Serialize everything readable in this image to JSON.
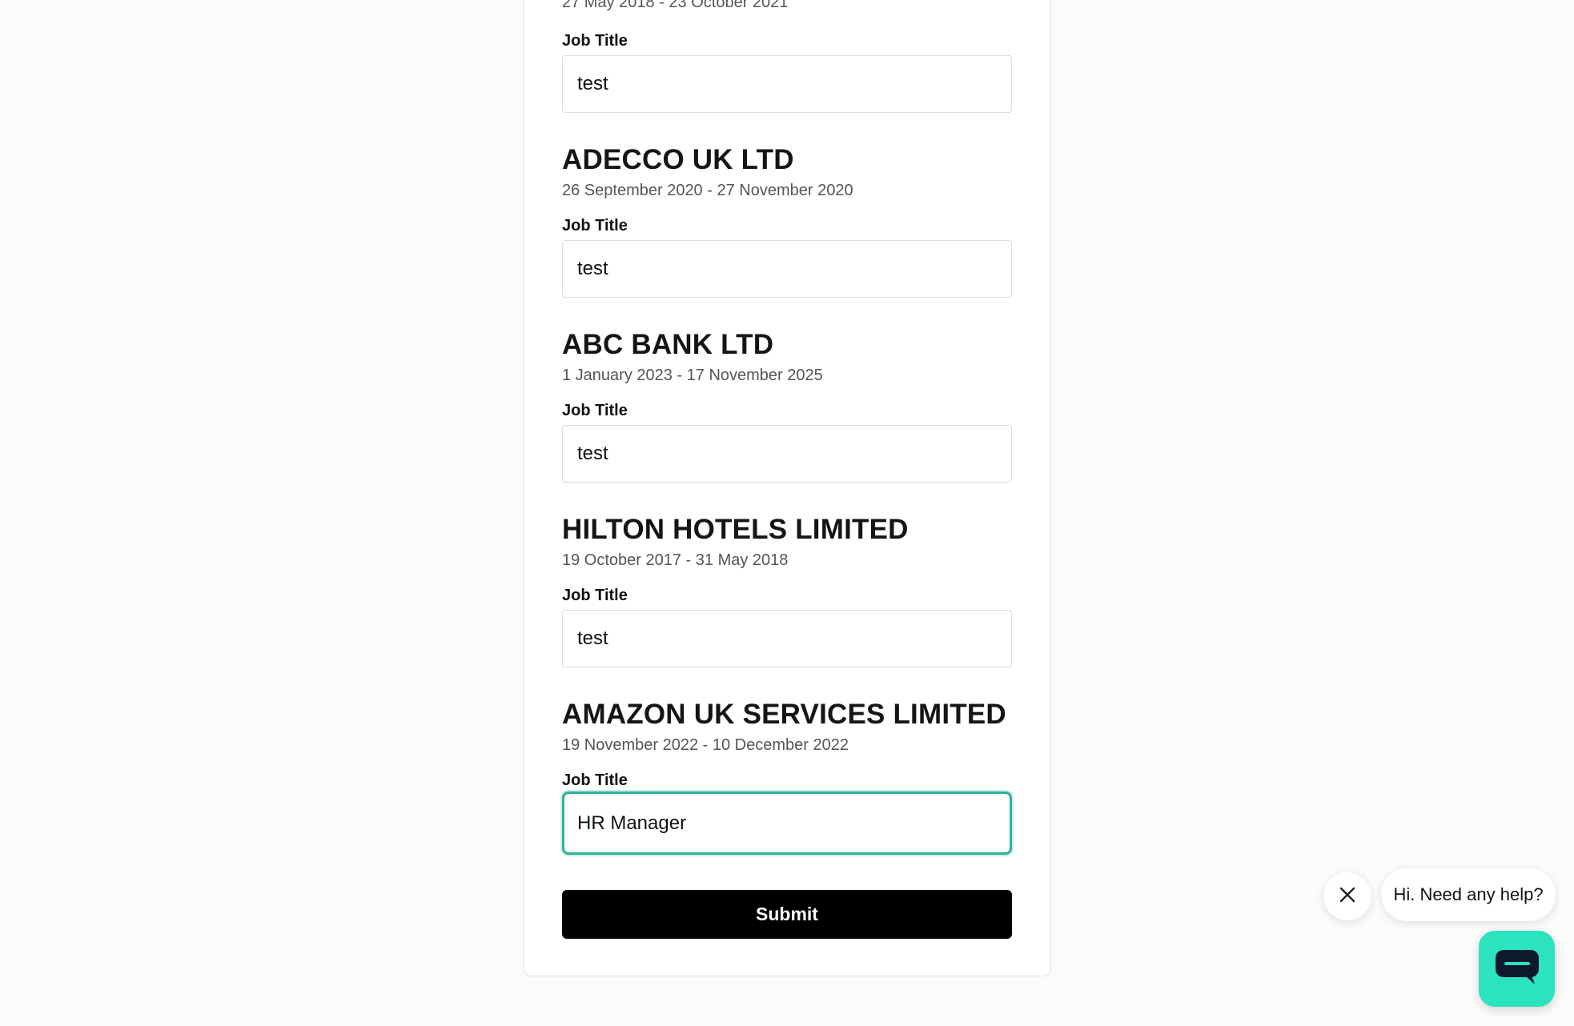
{
  "first_entry": {
    "dates": "27 May 2018 - 23 October 2021",
    "job_title_label": "Job Title",
    "job_title_value": "test"
  },
  "entries": [
    {
      "company": "ADECCO UK LTD",
      "dates": "26 September 2020 - 27 November 2020",
      "job_title_label": "Job Title",
      "job_title_value": "test"
    },
    {
      "company": "ABC BANK LTD",
      "dates": "1 January 2023 - 17 November 2025",
      "job_title_label": "Job Title",
      "job_title_value": "test"
    },
    {
      "company": "HILTON HOTELS LIMITED",
      "dates": "19 October 2017 - 31 May 2018",
      "job_title_label": "Job Title",
      "job_title_value": "test"
    },
    {
      "company": "AMAZON UK SERVICES LIMITED",
      "dates": "19 November 2022 - 10 December 2022",
      "job_title_label": "Job Title",
      "job_title_value": "HR Manager"
    }
  ],
  "form": {
    "submit_label": "Submit"
  },
  "chat": {
    "greeting": "Hi. Need any help?",
    "close_icon": "close-icon",
    "launcher_icon": "chat-bubble-icon",
    "accent_color": "#2de2c0"
  },
  "colors": {
    "focus_border": "#2bb39a",
    "button_bg": "#000000",
    "page_bg": "#fcfbf9"
  }
}
